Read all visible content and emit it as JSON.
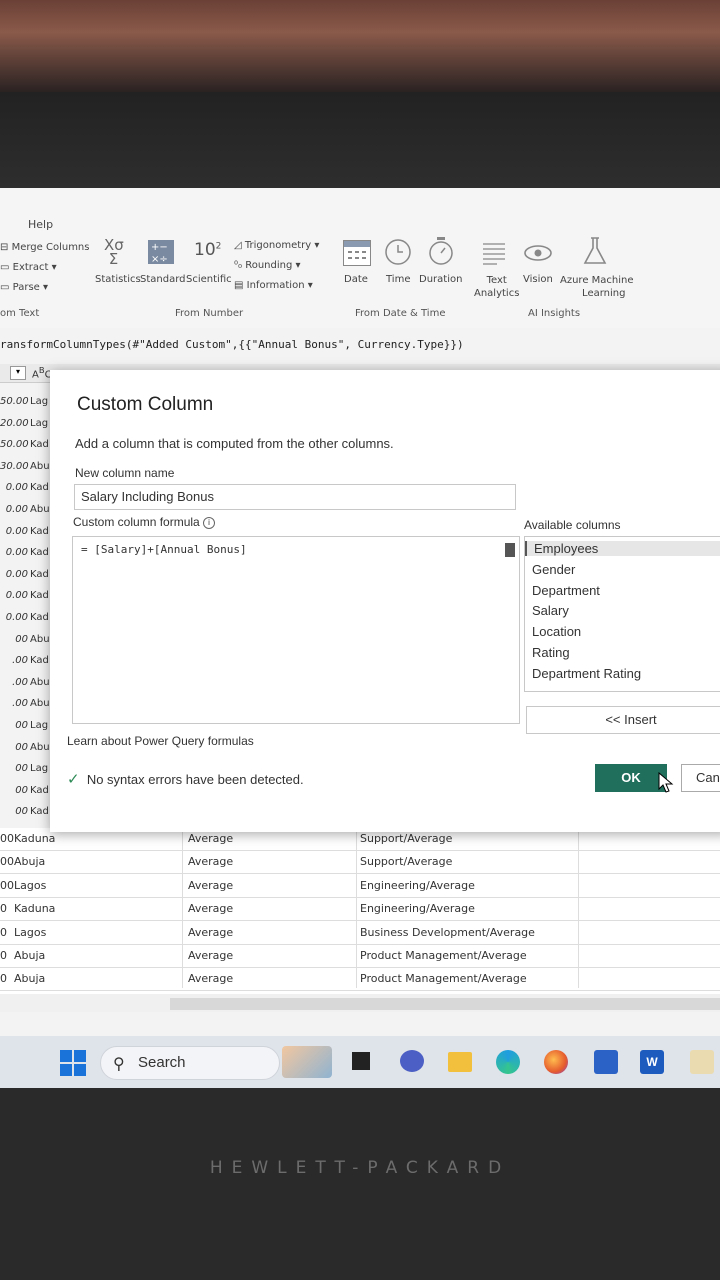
{
  "ribbon": {
    "tab_help": "Help",
    "merge_columns": "Merge Columns",
    "extract": "Extract",
    "parse": "Parse",
    "statistics": "Statistics",
    "standard": "Standard",
    "scientific": "Scientific",
    "ten_squared": "10",
    "trigonometry": "Trigonometry",
    "rounding": "Rounding",
    "information": "Information",
    "date": "Date",
    "time": "Time",
    "duration": "Duration",
    "text_analytics_1": "Text",
    "text_analytics_2": "Analytics",
    "vision": "Vision",
    "azure_ml_1": "Azure Machine",
    "azure_ml_2": "Learning",
    "group_from_text": "om Text",
    "group_from_number": "From Number",
    "group_from_datetime": "From Date & Time",
    "group_ai_insights": "AI Insights"
  },
  "formula_bar": {
    "text": "ransformColumnTypes(#\"Added Custom\",{{\"Annual Bonus\", Currency.Type}})"
  },
  "left_rows": [
    {
      "num": "50.00",
      "city": "Lag"
    },
    {
      "num": "20.00",
      "city": "Lag"
    },
    {
      "num": "50.00",
      "city": "Kad"
    },
    {
      "num": "30.00",
      "city": "Abu"
    },
    {
      "num": "0.00",
      "city": "Kad"
    },
    {
      "num": "0.00",
      "city": "Abu"
    },
    {
      "num": "0.00",
      "city": "Kad"
    },
    {
      "num": "0.00",
      "city": "Kad"
    },
    {
      "num": "0.00",
      "city": "Kad"
    },
    {
      "num": "0.00",
      "city": "Kad"
    },
    {
      "num": "0.00",
      "city": "Kad"
    },
    {
      "num": "00",
      "city": "Abu"
    },
    {
      "num": ".00",
      "city": "Kad"
    },
    {
      "num": ".00",
      "city": "Abu"
    },
    {
      "num": ".00",
      "city": "Abu"
    },
    {
      "num": "00",
      "city": "Lag"
    },
    {
      "num": "00",
      "city": "Abu"
    },
    {
      "num": "00",
      "city": "Lag"
    },
    {
      "num": "00",
      "city": "Kad"
    },
    {
      "num": "00",
      "city": "Kad"
    }
  ],
  "table_rows": [
    {
      "left": "00",
      "city": "Kaduna",
      "rating": "Average",
      "dept_rating": "Support/Average"
    },
    {
      "left": "00",
      "city": "Abuja",
      "rating": "Average",
      "dept_rating": "Support/Average"
    },
    {
      "left": "00",
      "city": "Lagos",
      "rating": "Average",
      "dept_rating": "Engineering/Average"
    },
    {
      "left": "0",
      "city": "Kaduna",
      "rating": "Average",
      "dept_rating": "Engineering/Average"
    },
    {
      "left": "0",
      "city": "Lagos",
      "rating": "Average",
      "dept_rating": "Business Development/Average"
    },
    {
      "left": "0",
      "city": "Abuja",
      "rating": "Average",
      "dept_rating": "Product Management/Average"
    },
    {
      "left": "0",
      "city": "Abuja",
      "rating": "Average",
      "dept_rating": "Product Management/Average"
    }
  ],
  "dialog": {
    "title": "Custom Column",
    "description": "Add a column that is computed from the other columns.",
    "new_column_label": "New column name",
    "new_column_value": "Salary Including Bonus",
    "formula_label": "Custom column formula",
    "formula_value": "= [Salary]+[Annual Bonus]",
    "available_label": "Available columns",
    "available_columns": [
      "Employees",
      "Gender",
      "Department",
      "Salary",
      "Location",
      "Rating",
      "Department Rating"
    ],
    "insert_button": "<< Insert",
    "learn_link": "Learn about Power Query formulas",
    "status": "No syntax errors have been detected.",
    "ok_button": "OK",
    "cancel_button": "Can"
  },
  "taskbar": {
    "search_label": "Search"
  },
  "brand": "HEWLETT-PACKARD",
  "colors": {
    "ok_green": "#1f6f5c",
    "check_green": "#2e8b57",
    "selection": "#e6e6e6"
  }
}
